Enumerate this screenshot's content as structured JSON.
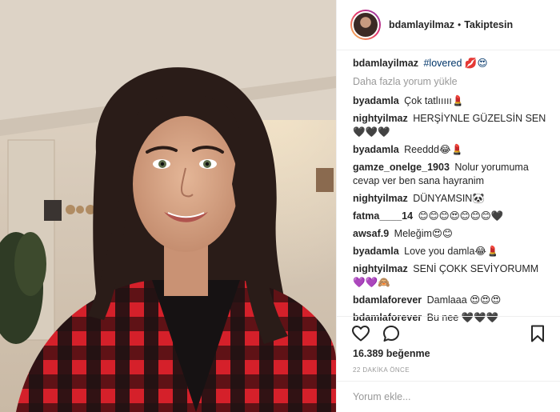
{
  "header": {
    "username": "bdamlayilmaz",
    "separator": "•",
    "follow_status": "Takiptesin"
  },
  "caption": {
    "user": "bdamlayilmaz",
    "text": "#lovered 💋😍"
  },
  "load_more": "Daha fazla yorum yükle",
  "comments": [
    {
      "user": "byadamla",
      "text": "Çok tatlııııı💄"
    },
    {
      "user": "nightyilmaz",
      "text": "HERŞİYNLE GÜZELSİN SEN🖤🖤🖤"
    },
    {
      "user": "byadamla",
      "text": "Reeddd😂💄"
    },
    {
      "user": "gamze_onelge_1903",
      "text": "Nolur yorumuma cevap ver ben sana hayranim"
    },
    {
      "user": "nightyilmaz",
      "text": "DÜNYAMSIN🐼"
    },
    {
      "user": "fatma____14",
      "text": "😊😊😊😍😊😊😊🖤"
    },
    {
      "user": "awsaf.9",
      "text": "Meleğim😍😊"
    },
    {
      "user": "byadamla",
      "text": "Love you damla😂💄"
    },
    {
      "user": "nightyilmaz",
      "text": "SENİ ÇOKK SEVİYORUMM💜💜🙈"
    },
    {
      "user": "bdamlaforever",
      "text": "Damlaaa 😍😍😍"
    },
    {
      "user": "bdamlaforever",
      "text": "Bu nee 🖤🖤🖤"
    }
  ],
  "actions": {
    "like_icon": "heart-icon",
    "comment_icon": "comment-bubble-icon",
    "save_icon": "bookmark-icon"
  },
  "likes": "16.389 beğenme",
  "timestamp": "22 DAKİKA ÖNCE",
  "add_comment": {
    "placeholder": "Yorum ekle..."
  }
}
